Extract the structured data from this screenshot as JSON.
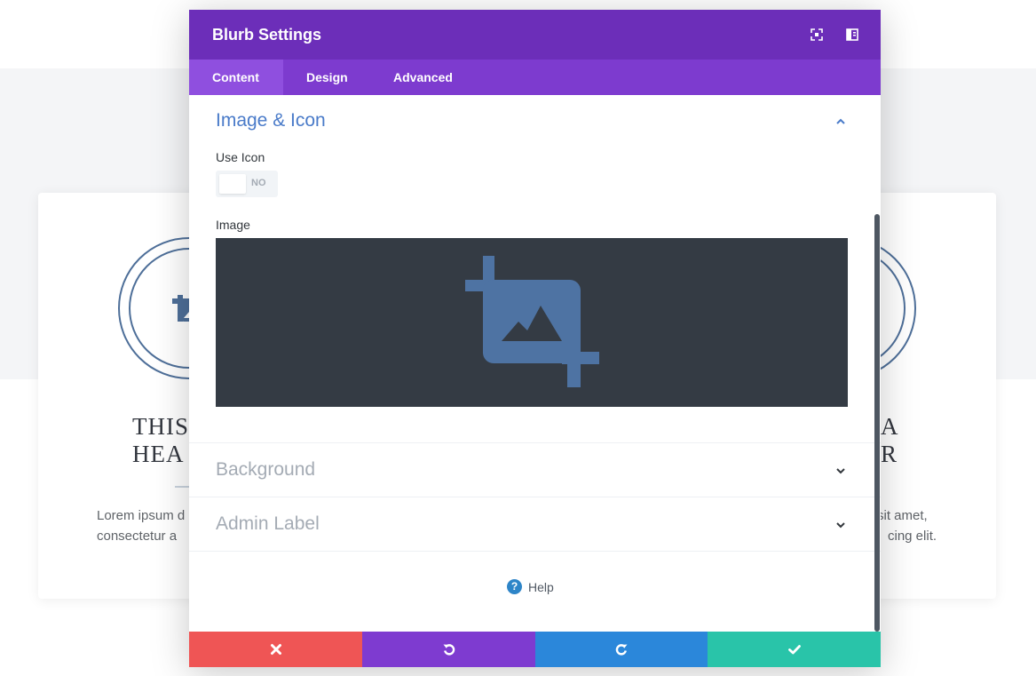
{
  "colors": {
    "header": "#6c2eb9",
    "tabs_bar": "#7d3bcf",
    "active_tab": "#8f4fdf",
    "section_active": "#4a7bc9",
    "cancel": "#ef5555",
    "undo": "#7e3bd0",
    "redo": "#2b87da",
    "save": "#29c4a9",
    "image_area": "#343b44"
  },
  "background_page": {
    "cards": [
      {
        "heading_line1": "THIS",
        "heading_line2": "HEA",
        "text_line1": "Lorem ipsum d",
        "text_line2": "consectetur a"
      },
      {
        "heading_line1": "A",
        "heading_line2": "R",
        "text_line1": "sit amet,",
        "text_line2": "cing elit."
      }
    ]
  },
  "modal": {
    "title": "Blurb Settings",
    "header_icons": [
      "expand-icon",
      "snap-to-side-icon"
    ],
    "tabs": [
      {
        "label": "Content",
        "active": true
      },
      {
        "label": "Design",
        "active": false
      },
      {
        "label": "Advanced",
        "active": false
      }
    ],
    "sections": {
      "image_icon": {
        "title": "Image & Icon",
        "expanded": true,
        "use_icon_label": "Use Icon",
        "use_icon_value": "NO",
        "image_label": "Image"
      },
      "background": {
        "title": "Background",
        "expanded": false
      },
      "admin_label": {
        "title": "Admin Label",
        "expanded": false
      }
    },
    "help": {
      "icon": "?",
      "label": "Help"
    },
    "footer_icons": [
      "close-icon",
      "undo-icon",
      "redo-icon",
      "check-icon"
    ]
  }
}
